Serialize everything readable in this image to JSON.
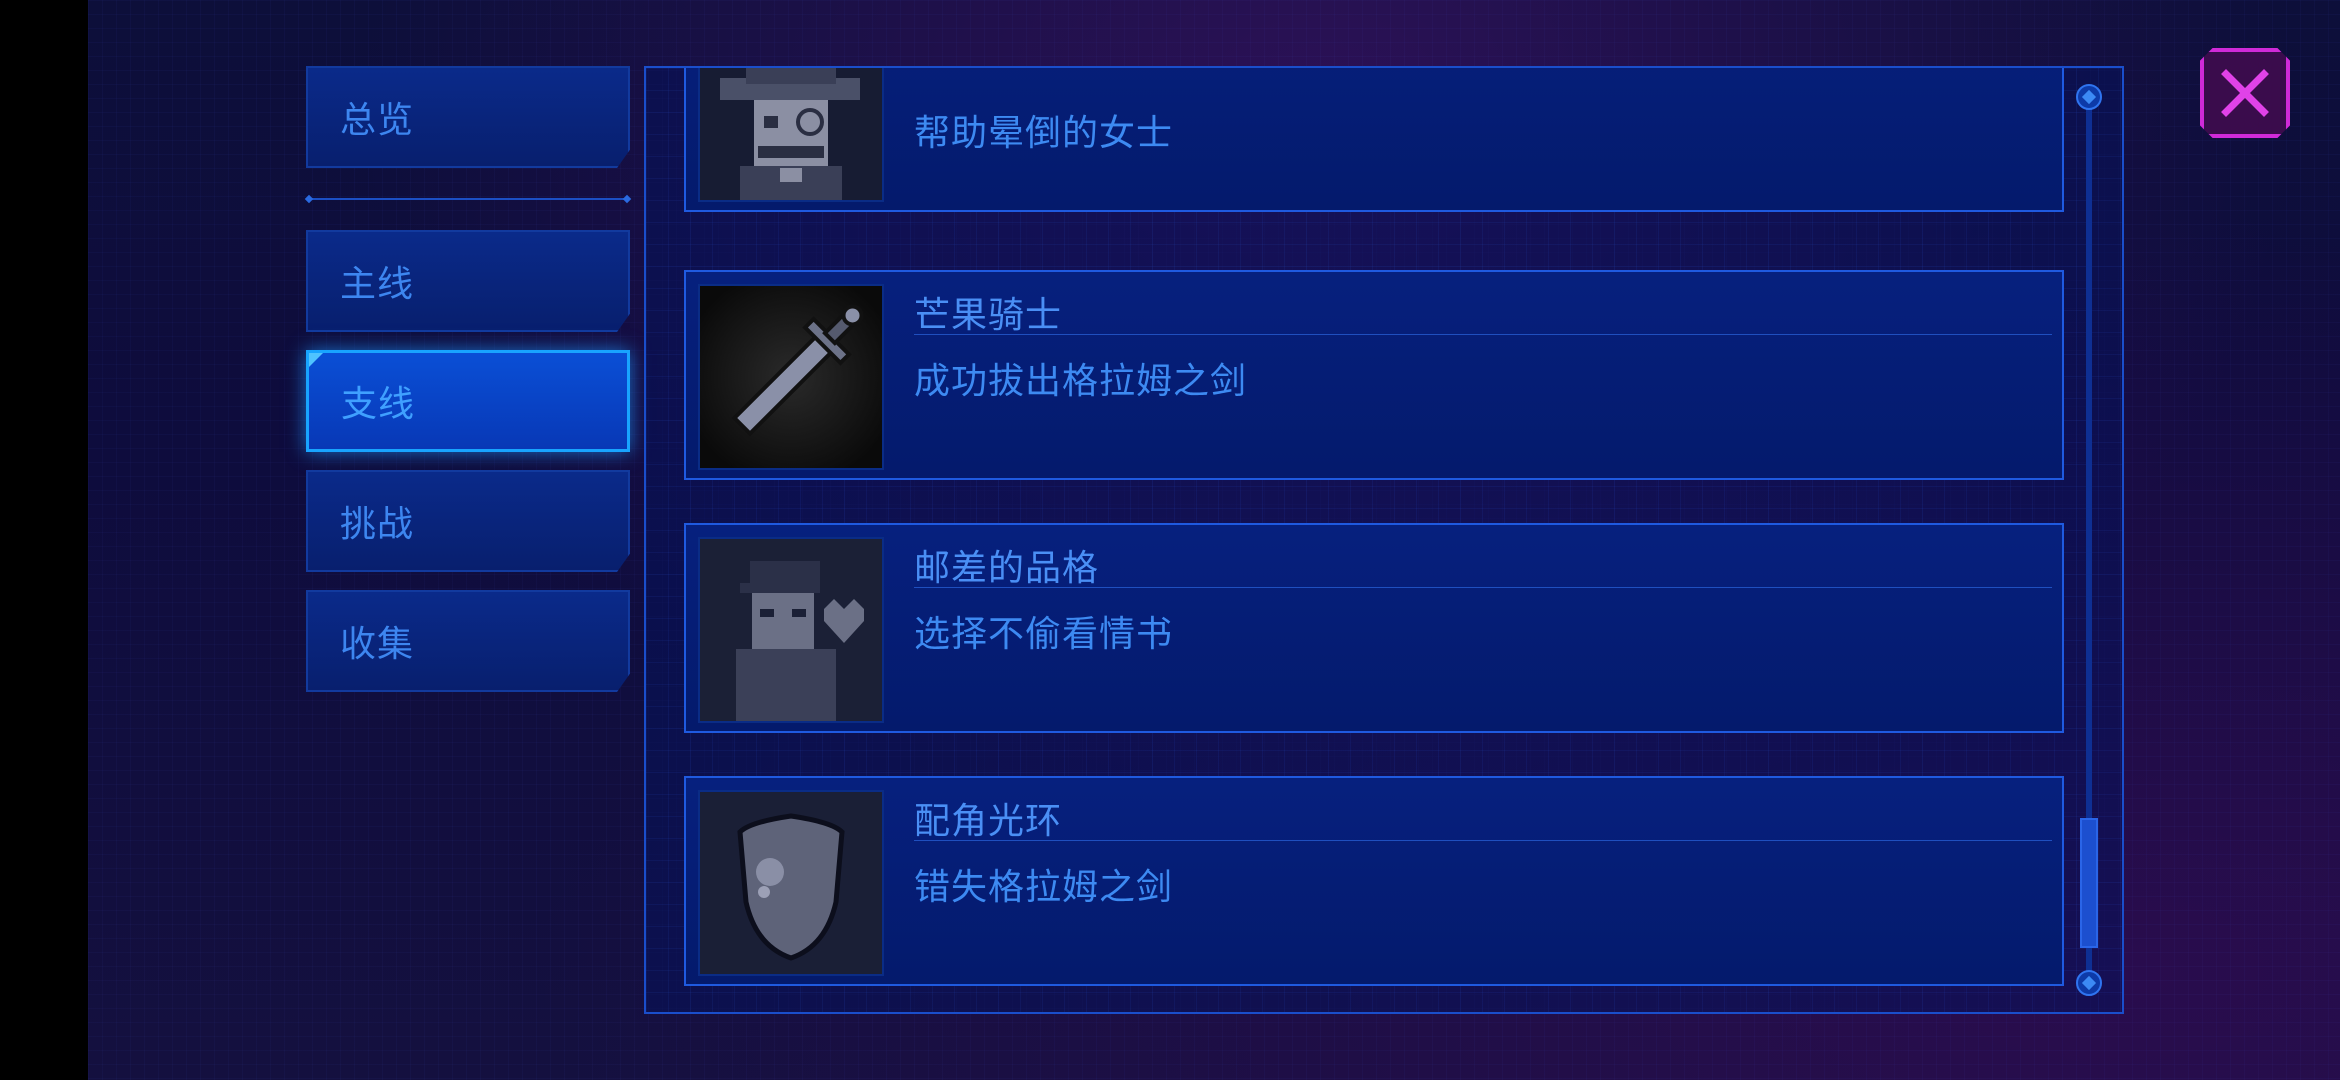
{
  "sidebar": {
    "items": [
      {
        "label": "总览",
        "active": false
      },
      {
        "label": "主线",
        "active": false
      },
      {
        "label": "支线",
        "active": true
      },
      {
        "label": "挑战",
        "active": false
      },
      {
        "label": "收集",
        "active": false
      }
    ]
  },
  "achievements": [
    {
      "title": "",
      "description": "帮助晕倒的女士",
      "icon": "mustache-gentleman-icon"
    },
    {
      "title": "芒果骑士",
      "description": "成功拔出格拉姆之剑",
      "icon": "sword-icon"
    },
    {
      "title": "邮差的品格",
      "description": "选择不偷看情书",
      "icon": "postman-heart-icon"
    },
    {
      "title": "配角光环",
      "description": "错失格拉姆之剑",
      "icon": "shield-icon"
    }
  ],
  "close": {
    "icon": "close-icon"
  },
  "scroll": {
    "position": 0.92
  },
  "colors": {
    "accent": "#1aa4ff",
    "text": "#4a8ff5",
    "close": "#d02ad8",
    "panel": "#061a6c"
  }
}
